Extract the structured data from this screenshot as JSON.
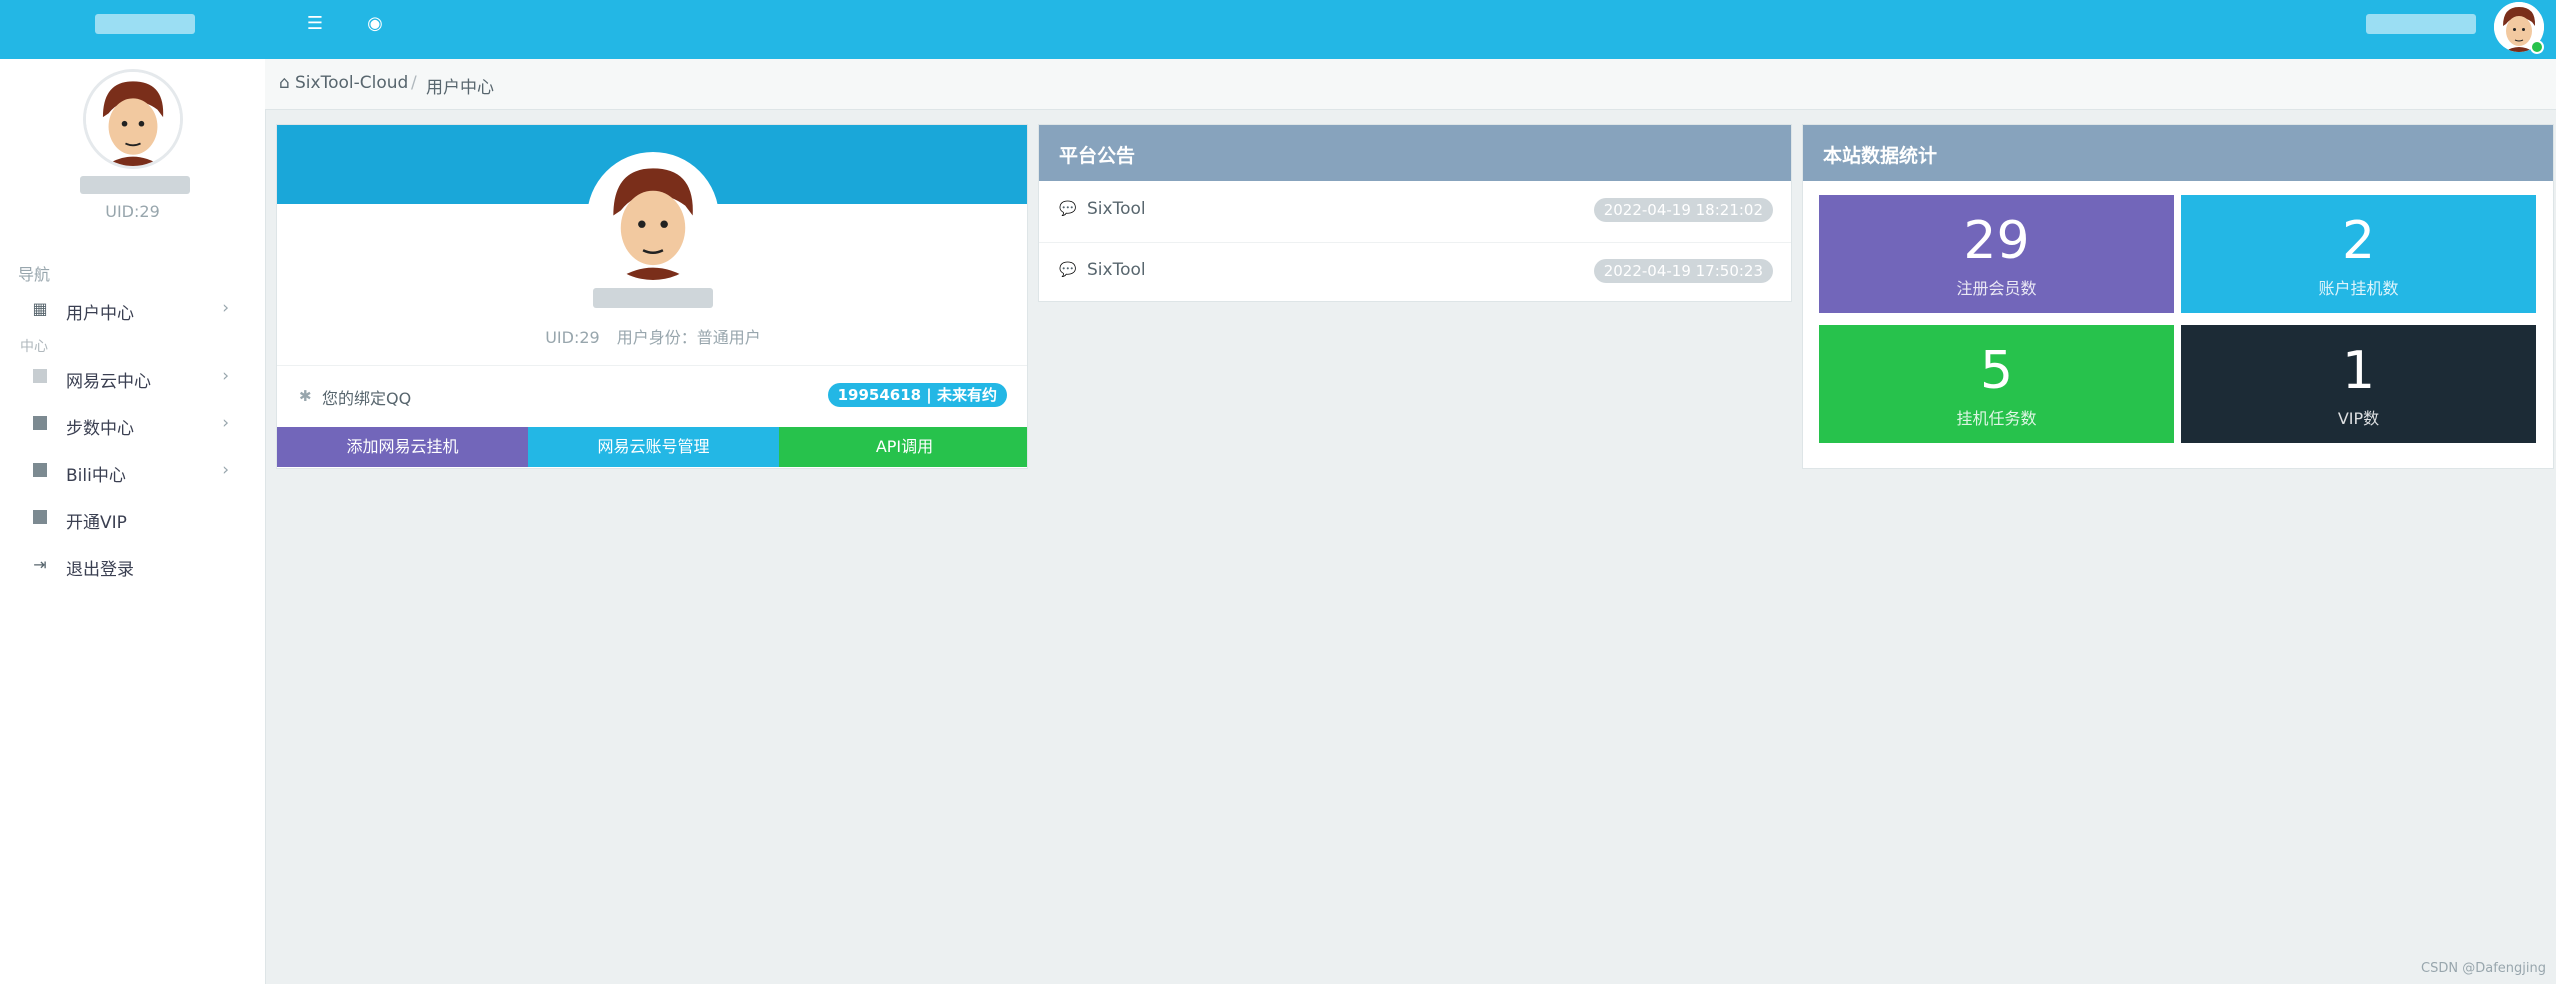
{
  "topbar": {
    "icons": [
      "menu-icon",
      "user-circle-icon"
    ]
  },
  "sidebar": {
    "uid": "UID:29",
    "nav_header": "导航",
    "group_label": "中心",
    "items": [
      {
        "label": "用户中心",
        "icon": "grid-icon"
      },
      {
        "label": "网易云中心",
        "icon": "square-icon"
      },
      {
        "label": "步数中心",
        "icon": "square-icon"
      },
      {
        "label": "Bili中心",
        "icon": "square-icon"
      },
      {
        "label": "开通VIP",
        "icon": "square-icon"
      },
      {
        "label": "退出登录",
        "icon": "sign-out-icon"
      }
    ]
  },
  "breadcrumb": {
    "home": "SixTool-Cloud",
    "sep": "/",
    "current": "用户中心"
  },
  "profile": {
    "uid": "UID:29",
    "role": "用户身份：普通用户",
    "qq_label": "您的绑定QQ",
    "qq_badge": "19954618 | 未来有约",
    "buttons": [
      "添加网易云挂机",
      "网易云账号管理",
      "API调用"
    ]
  },
  "announcements": {
    "title": "平台公告",
    "items": [
      {
        "text": "SixTool",
        "date": "2022-04-19 18:21:02"
      },
      {
        "text": "SixTool",
        "date": "2022-04-19 17:50:23"
      }
    ]
  },
  "stats": {
    "title": "本站数据统计",
    "cards": [
      {
        "value": "29",
        "label": "注册会员数",
        "color": "#7266ba"
      },
      {
        "value": "2",
        "label": "账户挂机数",
        "color": "#23b7e5"
      },
      {
        "value": "5",
        "label": "挂机任务数",
        "color": "#27c24c"
      },
      {
        "value": "1",
        "label": "VIP数",
        "color": "#1c2b36"
      }
    ]
  },
  "watermark": "CSDN @Dafengjing",
  "colors": {
    "topbar": "#23b7e5",
    "panel_header": "#87a3bd",
    "btn1": "#7266ba",
    "btn2": "#23b7e5",
    "btn3": "#27c24c"
  }
}
